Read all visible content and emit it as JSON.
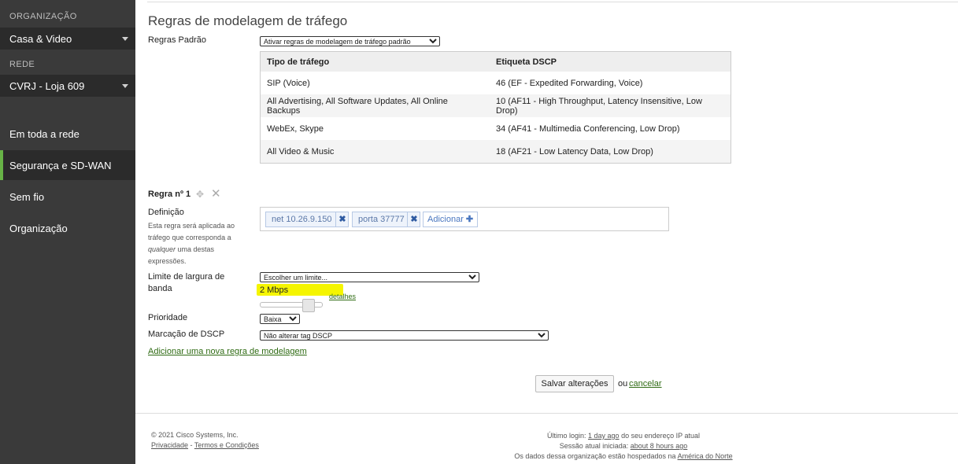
{
  "sidebar": {
    "org_label": "ORGANIZAÇÃO",
    "org_value": "Casa & Video",
    "network_label": "REDE",
    "network_value": "CVRJ - Loja 609",
    "items": [
      {
        "label": "Em toda a rede"
      },
      {
        "label": "Segurança e SD-WAN"
      },
      {
        "label": "Sem fio"
      },
      {
        "label": "Organização"
      }
    ]
  },
  "page": {
    "title": "Regras de modelagem de tráfego",
    "default_rules_label": "Regras Padrão",
    "default_rules_value": "Ativar regras de modelagem de tráfego padrão"
  },
  "table": {
    "headers": [
      "Tipo de tráfego",
      "Etiqueta DSCP"
    ],
    "rows": [
      [
        "SIP (Voice)",
        "46 (EF - Expedited Forwarding, Voice)"
      ],
      [
        "All Advertising, All Software Updates, All Online Backups",
        "10 (AF11 - High Throughput, Latency Insensitive, Low Drop)"
      ],
      [
        "WebEx, Skype",
        "34 (AF41 - Multimedia Conferencing, Low Drop)"
      ],
      [
        "All Video & Music",
        "18 (AF21 - Low Latency Data, Low Drop)"
      ]
    ]
  },
  "rule": {
    "title": "Regra nº 1",
    "definition_label": "Definição",
    "definition_note_1": "Esta regra será aplicada ao tráfego que corresponda a ",
    "definition_note_em": "qualquer",
    "definition_note_2": " uma destas expressões.",
    "chips": [
      "net 10.26.9.150",
      "porta 37777"
    ],
    "add_label": "Adicionar",
    "bandwidth_label": "Limite de largura de banda",
    "bandwidth_select": "Escolher um limite...",
    "bandwidth_value": "2 Mbps",
    "bandwidth_level_fraction": 0.85,
    "details_link": "detalhes",
    "priority_label": "Prioridade",
    "priority_value": "Baixa",
    "dscp_label": "Marcação de DSCP",
    "dscp_value": "Não alterar tag DSCP",
    "add_rule_link": "Adicionar uma nova regra de modelagem"
  },
  "actions": {
    "save": "Salvar alterações",
    "or": "ou",
    "cancel": "cancelar"
  },
  "footer": {
    "copyright": "© 2021 Cisco Systems, Inc.",
    "privacy": "Privacidade",
    "separator": " - ",
    "terms": "Termos e Condições",
    "last_login_prefix": "Último login: ",
    "last_login_value": "1 day ago",
    "last_login_suffix": " do seu endereço IP atual",
    "session_prefix": "Sessão atual iniciada: ",
    "session_value": "about 8 hours ago",
    "hosted_prefix": "Os dados dessa organização estão hospedados na ",
    "hosted_value": "América do Norte"
  },
  "colors": {
    "sidebar_bg": "#3a3a3a",
    "active_accent": "#67b346",
    "link": "#2f6b13",
    "highlight": "#f5f500"
  }
}
